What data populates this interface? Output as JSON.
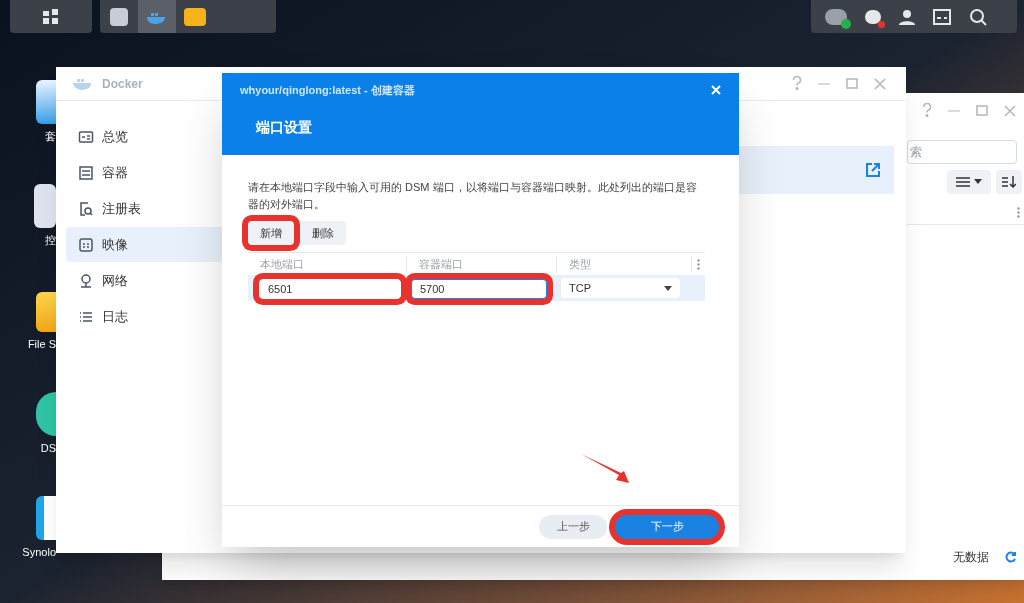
{
  "desktop_icons": [
    {
      "kind": "package",
      "label": "套"
    },
    {
      "kind": "control",
      "label": "控"
    },
    {
      "kind": "folder",
      "label": "File S"
    },
    {
      "kind": "dsm",
      "label": "DS"
    },
    {
      "kind": "synology",
      "label": "Synolo"
    }
  ],
  "back_window": {
    "search_placeholder": "索",
    "status": "无数据"
  },
  "docker_window": {
    "title": "Docker",
    "sidebar": [
      {
        "kind": "overview",
        "label": "总览",
        "selected": false
      },
      {
        "kind": "container",
        "label": "容器",
        "selected": false
      },
      {
        "kind": "registry",
        "label": "注册表",
        "selected": false
      },
      {
        "kind": "image",
        "label": "映像",
        "selected": true
      },
      {
        "kind": "network",
        "label": "网络",
        "selected": false
      },
      {
        "kind": "log",
        "label": "日志",
        "selected": false
      }
    ]
  },
  "dialog": {
    "title": "whyour/qinglong:latest - 创建容器",
    "section": "端口设置",
    "description": "请在本地端口字段中输入可用的 DSM 端口，以将端口与容器端口映射。此处列出的端口是容器的对外端口。",
    "toolbar": [
      {
        "label": "新增",
        "annotated": true
      },
      {
        "label": "删除",
        "annotated": false
      }
    ],
    "columns": [
      "本地端口",
      "容器端口",
      "类型"
    ],
    "rows": [
      {
        "selected": true,
        "local": {
          "value": "6501",
          "annotated": true,
          "focused": false
        },
        "container": {
          "value": "5700",
          "annotated": true,
          "focused": true
        },
        "type": "TCP"
      }
    ],
    "footer": [
      {
        "kind": "secondary",
        "label": "上一步",
        "annotated": false
      },
      {
        "kind": "primary",
        "label": "下一步",
        "annotated": true
      }
    ]
  }
}
